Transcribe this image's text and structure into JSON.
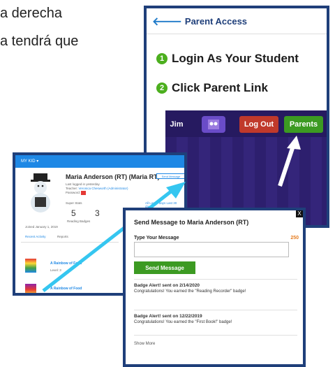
{
  "background_text": {
    "line1": "a derecha",
    "line2": "a tendrá que"
  },
  "parent_access": {
    "header": "Parent Access",
    "step1_num": "1",
    "step1": "Login As Your Student",
    "step2_num": "2",
    "step2": "Click Parent Link",
    "strip": {
      "user": "Jim",
      "logout": "Log Out",
      "parents": "Parents"
    }
  },
  "kid_profile": {
    "topbar": "MY KID ▾",
    "name": "Maria Anderson (RT) (Maria RT)",
    "last_login": "Last logged in yesterday",
    "teacher_label": "Teacher:",
    "teacher": "Veronica Chesworth (Administrator)",
    "password_label": "Password:",
    "send_message": "Send Message",
    "super_stats": "Super Stats",
    "stats_range": "All  Last 7 days  Last 30 days",
    "stat1": "5",
    "stat2": "3",
    "stat1_label": "Reading Badges",
    "joined": "Joined January 1, 2019",
    "tabs": [
      "Recent Activity",
      "Reports"
    ],
    "activity": [
      {
        "title": "A Rainbow of Food",
        "sub": "Level: 3"
      },
      {
        "title": "A Rainbow of Food",
        "sub": ""
      }
    ]
  },
  "modal": {
    "title": "Send Message to Maria Anderson (RT)",
    "type_label": "Type Your Message",
    "char_count": "250",
    "send_button": "Send Message",
    "alerts": [
      {
        "title": "Badge Alert! sent on 2/14/2020",
        "text": "Congratulations! You earned the \"Reading Recorder\" badge!"
      },
      {
        "title": "Badge Alert! sent on 12/22/2019",
        "text": "Congratulations! You earned the \"First Book!\" badge!"
      }
    ],
    "show_more": "Show More",
    "close": "X"
  },
  "colors": {
    "frame": "#1f3f7a",
    "accent_blue": "#1e88e5",
    "green": "#4caf1e",
    "arrow_cyan": "#35c6f0"
  }
}
